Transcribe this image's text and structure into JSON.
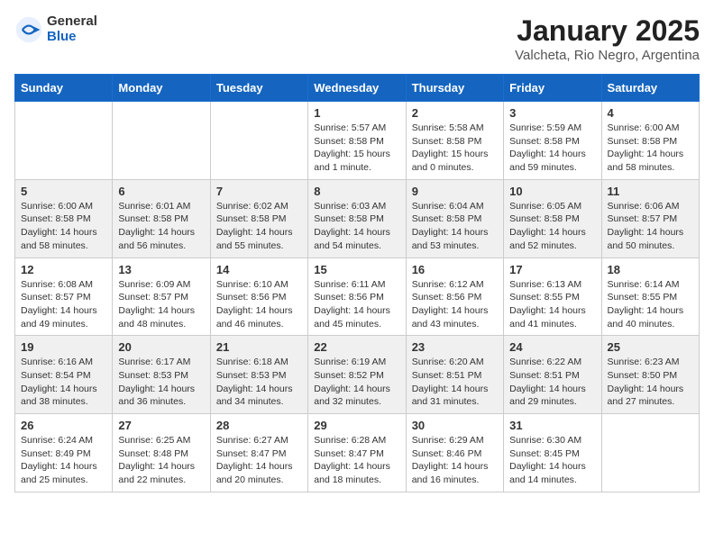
{
  "header": {
    "logo": {
      "general": "General",
      "blue": "Blue"
    },
    "title": "January 2025",
    "location": "Valcheta, Rio Negro, Argentina"
  },
  "calendar": {
    "days_of_week": [
      "Sunday",
      "Monday",
      "Tuesday",
      "Wednesday",
      "Thursday",
      "Friday",
      "Saturday"
    ],
    "weeks": [
      [
        {
          "day": "",
          "info": ""
        },
        {
          "day": "",
          "info": ""
        },
        {
          "day": "",
          "info": ""
        },
        {
          "day": "1",
          "info": "Sunrise: 5:57 AM\nSunset: 8:58 PM\nDaylight: 15 hours\nand 1 minute."
        },
        {
          "day": "2",
          "info": "Sunrise: 5:58 AM\nSunset: 8:58 PM\nDaylight: 15 hours\nand 0 minutes."
        },
        {
          "day": "3",
          "info": "Sunrise: 5:59 AM\nSunset: 8:58 PM\nDaylight: 14 hours\nand 59 minutes."
        },
        {
          "day": "4",
          "info": "Sunrise: 6:00 AM\nSunset: 8:58 PM\nDaylight: 14 hours\nand 58 minutes."
        }
      ],
      [
        {
          "day": "5",
          "info": "Sunrise: 6:00 AM\nSunset: 8:58 PM\nDaylight: 14 hours\nand 58 minutes."
        },
        {
          "day": "6",
          "info": "Sunrise: 6:01 AM\nSunset: 8:58 PM\nDaylight: 14 hours\nand 56 minutes."
        },
        {
          "day": "7",
          "info": "Sunrise: 6:02 AM\nSunset: 8:58 PM\nDaylight: 14 hours\nand 55 minutes."
        },
        {
          "day": "8",
          "info": "Sunrise: 6:03 AM\nSunset: 8:58 PM\nDaylight: 14 hours\nand 54 minutes."
        },
        {
          "day": "9",
          "info": "Sunrise: 6:04 AM\nSunset: 8:58 PM\nDaylight: 14 hours\nand 53 minutes."
        },
        {
          "day": "10",
          "info": "Sunrise: 6:05 AM\nSunset: 8:58 PM\nDaylight: 14 hours\nand 52 minutes."
        },
        {
          "day": "11",
          "info": "Sunrise: 6:06 AM\nSunset: 8:57 PM\nDaylight: 14 hours\nand 50 minutes."
        }
      ],
      [
        {
          "day": "12",
          "info": "Sunrise: 6:08 AM\nSunset: 8:57 PM\nDaylight: 14 hours\nand 49 minutes."
        },
        {
          "day": "13",
          "info": "Sunrise: 6:09 AM\nSunset: 8:57 PM\nDaylight: 14 hours\nand 48 minutes."
        },
        {
          "day": "14",
          "info": "Sunrise: 6:10 AM\nSunset: 8:56 PM\nDaylight: 14 hours\nand 46 minutes."
        },
        {
          "day": "15",
          "info": "Sunrise: 6:11 AM\nSunset: 8:56 PM\nDaylight: 14 hours\nand 45 minutes."
        },
        {
          "day": "16",
          "info": "Sunrise: 6:12 AM\nSunset: 8:56 PM\nDaylight: 14 hours\nand 43 minutes."
        },
        {
          "day": "17",
          "info": "Sunrise: 6:13 AM\nSunset: 8:55 PM\nDaylight: 14 hours\nand 41 minutes."
        },
        {
          "day": "18",
          "info": "Sunrise: 6:14 AM\nSunset: 8:55 PM\nDaylight: 14 hours\nand 40 minutes."
        }
      ],
      [
        {
          "day": "19",
          "info": "Sunrise: 6:16 AM\nSunset: 8:54 PM\nDaylight: 14 hours\nand 38 minutes."
        },
        {
          "day": "20",
          "info": "Sunrise: 6:17 AM\nSunset: 8:53 PM\nDaylight: 14 hours\nand 36 minutes."
        },
        {
          "day": "21",
          "info": "Sunrise: 6:18 AM\nSunset: 8:53 PM\nDaylight: 14 hours\nand 34 minutes."
        },
        {
          "day": "22",
          "info": "Sunrise: 6:19 AM\nSunset: 8:52 PM\nDaylight: 14 hours\nand 32 minutes."
        },
        {
          "day": "23",
          "info": "Sunrise: 6:20 AM\nSunset: 8:51 PM\nDaylight: 14 hours\nand 31 minutes."
        },
        {
          "day": "24",
          "info": "Sunrise: 6:22 AM\nSunset: 8:51 PM\nDaylight: 14 hours\nand 29 minutes."
        },
        {
          "day": "25",
          "info": "Sunrise: 6:23 AM\nSunset: 8:50 PM\nDaylight: 14 hours\nand 27 minutes."
        }
      ],
      [
        {
          "day": "26",
          "info": "Sunrise: 6:24 AM\nSunset: 8:49 PM\nDaylight: 14 hours\nand 25 minutes."
        },
        {
          "day": "27",
          "info": "Sunrise: 6:25 AM\nSunset: 8:48 PM\nDaylight: 14 hours\nand 22 minutes."
        },
        {
          "day": "28",
          "info": "Sunrise: 6:27 AM\nSunset: 8:47 PM\nDaylight: 14 hours\nand 20 minutes."
        },
        {
          "day": "29",
          "info": "Sunrise: 6:28 AM\nSunset: 8:47 PM\nDaylight: 14 hours\nand 18 minutes."
        },
        {
          "day": "30",
          "info": "Sunrise: 6:29 AM\nSunset: 8:46 PM\nDaylight: 14 hours\nand 16 minutes."
        },
        {
          "day": "31",
          "info": "Sunrise: 6:30 AM\nSunset: 8:45 PM\nDaylight: 14 hours\nand 14 minutes."
        },
        {
          "day": "",
          "info": ""
        }
      ]
    ]
  }
}
